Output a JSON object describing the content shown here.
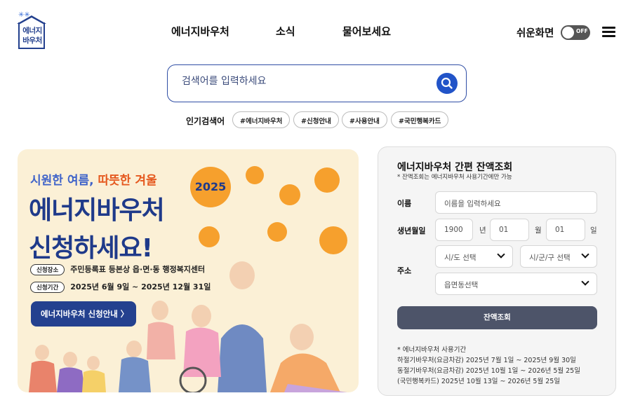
{
  "header": {
    "logo_line1": "에너지",
    "logo_line2": "바우처",
    "nav": [
      "에너지바우처",
      "소식",
      "물어보세요"
    ],
    "easy_view_label": "쉬운화면",
    "toggle_state": "OFF"
  },
  "search": {
    "placeholder": "검색어를 입력하세요",
    "popular_label": "인기검색어",
    "tags": [
      "#에너지바우처",
      "#신청안내",
      "#사용안내",
      "#국민행복카드"
    ]
  },
  "banner": {
    "subtitle_a": "시원한 여름,",
    "subtitle_b": "따뜻한 겨울",
    "title_line1": "에너지바우처",
    "title_line2": "신청하세요!",
    "place_label": "신청장소",
    "place_text": "주민등록표 등본상 읍·면·동 행정복지센터",
    "period_label": "신청기간",
    "period_text": "2025년 6월 9일 ~ 2025년 12월 31일",
    "button": "에너지바우처 신청안내 〉",
    "year_badge": "2025"
  },
  "balance": {
    "title": "에너지바우처 간편 잔액조회",
    "subtitle": "* 잔액조회는 에너지바우처 사용기간에만 가능",
    "name_label": "이름",
    "name_placeholder": "이름을 입력하세요",
    "birth_label": "생년월일",
    "year_value": "1900",
    "year_unit": "년",
    "month_value": "01",
    "month_unit": "월",
    "day_value": "01",
    "day_unit": "일",
    "address_label": "주소",
    "sido_select": "시/도 선택",
    "sigungu_select": "시/군/구 선택",
    "eupmyeondong_select": "읍면동선택",
    "submit": "잔액조회",
    "notes": [
      "* 에너지바우처 사용기간",
      "하절기바우처(요금차감) 2025년 7월 1일 ~ 2025년 9월 30일",
      "동절기바우처(요금차감) 2025년 10월 1일 ~ 2026년 5월 25일",
      "(국민행복카드) 2025년 10월 13일 ~ 2026년 5월 25일"
    ]
  },
  "colors": {
    "brand_blue": "#23408e",
    "search_blue": "#2254c8",
    "banner_bg": "#fbf0d6",
    "accent_orange": "#f6a02d",
    "submit_gray": "#4d5469"
  }
}
